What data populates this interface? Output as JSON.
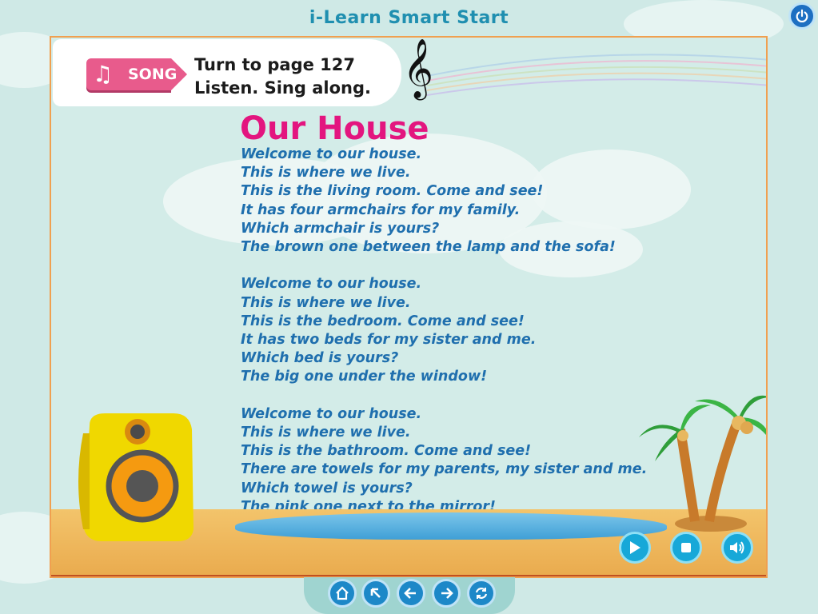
{
  "app": {
    "title": "i-Learn Smart Start"
  },
  "header": {
    "tag_label": "SONG",
    "instruction_line1": "Turn to page 127",
    "instruction_line2": "Listen. Sing along."
  },
  "song": {
    "title": "Our House",
    "stanzas": [
      [
        "Welcome to our house.",
        "This is where we live.",
        "This is the living room. Come and see!",
        "It has four armchairs for my family.",
        "Which armchair is yours?",
        "The brown one between the lamp and the sofa!"
      ],
      [
        "Welcome to our house.",
        "This is where we live.",
        "This is the bedroom. Come and see!",
        "It has two beds for my sister and me.",
        "Which bed is yours?",
        "The big one under the window!"
      ],
      [
        "Welcome to our house.",
        "This is where we live.",
        "This is the bathroom. Come and see!",
        "There are towels for my parents, my sister and me.",
        "Which towel is yours?",
        "The pink one next to the mirror!"
      ]
    ]
  },
  "icons": {
    "power": "power-icon",
    "play": "play-icon",
    "stop": "stop-icon",
    "volume": "volume-icon",
    "home": "home-icon",
    "back_to_top": "arrow-up-left-icon",
    "previous": "arrow-left-icon",
    "next": "arrow-right-icon",
    "refresh": "refresh-icon"
  },
  "colors": {
    "title_pink": "#e3157f",
    "lyrics_blue": "#1f6fae",
    "button_blue": "#17a8d8",
    "frame_border": "#f0a050"
  }
}
